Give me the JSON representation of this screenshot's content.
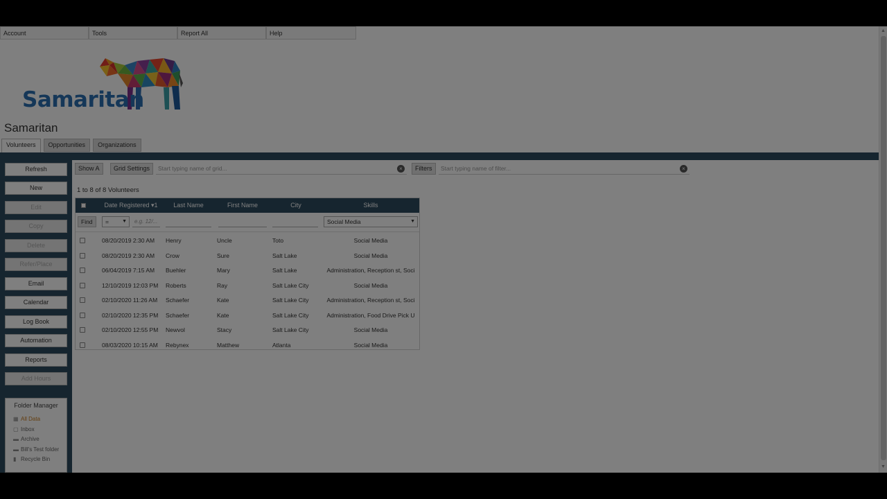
{
  "menu": [
    "Account",
    "Tools",
    "Report All",
    "Help"
  ],
  "logo": {
    "wordmark": "Samaritan"
  },
  "app_title": "Samaritan",
  "tabs": [
    "Volunteers",
    "Opportunities",
    "Organizations"
  ],
  "sidebar": {
    "buttons": [
      {
        "label": "Refresh",
        "disabled": false
      },
      {
        "label": "New",
        "disabled": false
      },
      {
        "label": "Edit",
        "disabled": true
      },
      {
        "label": "Copy",
        "disabled": true
      },
      {
        "label": "Delete",
        "disabled": true
      },
      {
        "label": "Refer/Place",
        "disabled": true
      },
      {
        "label": "Email",
        "disabled": false
      },
      {
        "label": "Calendar",
        "disabled": false
      },
      {
        "label": "Log Book",
        "disabled": false
      },
      {
        "label": "Automation",
        "disabled": false
      },
      {
        "label": "Reports",
        "disabled": false
      },
      {
        "label": "Add Hours",
        "disabled": true
      }
    ],
    "folder_manager": {
      "title": "Folder Manager",
      "items": [
        "All Data",
        "Inbox",
        "Archive",
        "Bill's Test folder",
        "Recycle Bin"
      ]
    }
  },
  "toolbar": {
    "show_all": "Show A",
    "grid_settings": "Grid Settings",
    "grid_placeholder": "Start typing name of grid...",
    "filters": "Filters",
    "filter_placeholder": "Start typing name of filter..."
  },
  "count_label": "1 to 8 of 8 Volunteers",
  "grid": {
    "columns": [
      "Date Registered ▾1",
      "Last Name",
      "First Name",
      "City",
      "Skills"
    ],
    "find": "Find",
    "op_select": "=",
    "date_placeholder": "e.g. 12/...",
    "skills_select": "Social Media",
    "rows": [
      [
        "08/20/2019 2:30 AM",
        "Henry",
        "Uncle",
        "Toto",
        "Social Media"
      ],
      [
        "08/20/2019 2:30 AM",
        "Crow",
        "Sure",
        "Salt Lake",
        "Social Media"
      ],
      [
        "06/04/2019 7:15 AM",
        "Buehler",
        "Mary",
        "Salt Lake",
        "Administration, Reception st, Soci"
      ],
      [
        "12/10/2019 12:03 PM",
        "Roberts",
        "Ray",
        "Salt Lake City",
        "Social Media"
      ],
      [
        "02/10/2020 11:26 AM",
        "Schaefer",
        "Kate",
        "Salt Lake City",
        "Administration, Reception st, Soci"
      ],
      [
        "02/10/2020 12:35 PM",
        "Schaefer",
        "Kate",
        "Salt Lake City",
        "Administration, Food Drive Pick U"
      ],
      [
        "02/10/2020 12:55 PM",
        "Newvol",
        "Stacy",
        "Salt Lake City",
        "Social Media"
      ],
      [
        "08/03/2020 10:15 AM",
        "Rebynex",
        "Matthew",
        "Atlanta",
        "Social Media"
      ]
    ]
  }
}
